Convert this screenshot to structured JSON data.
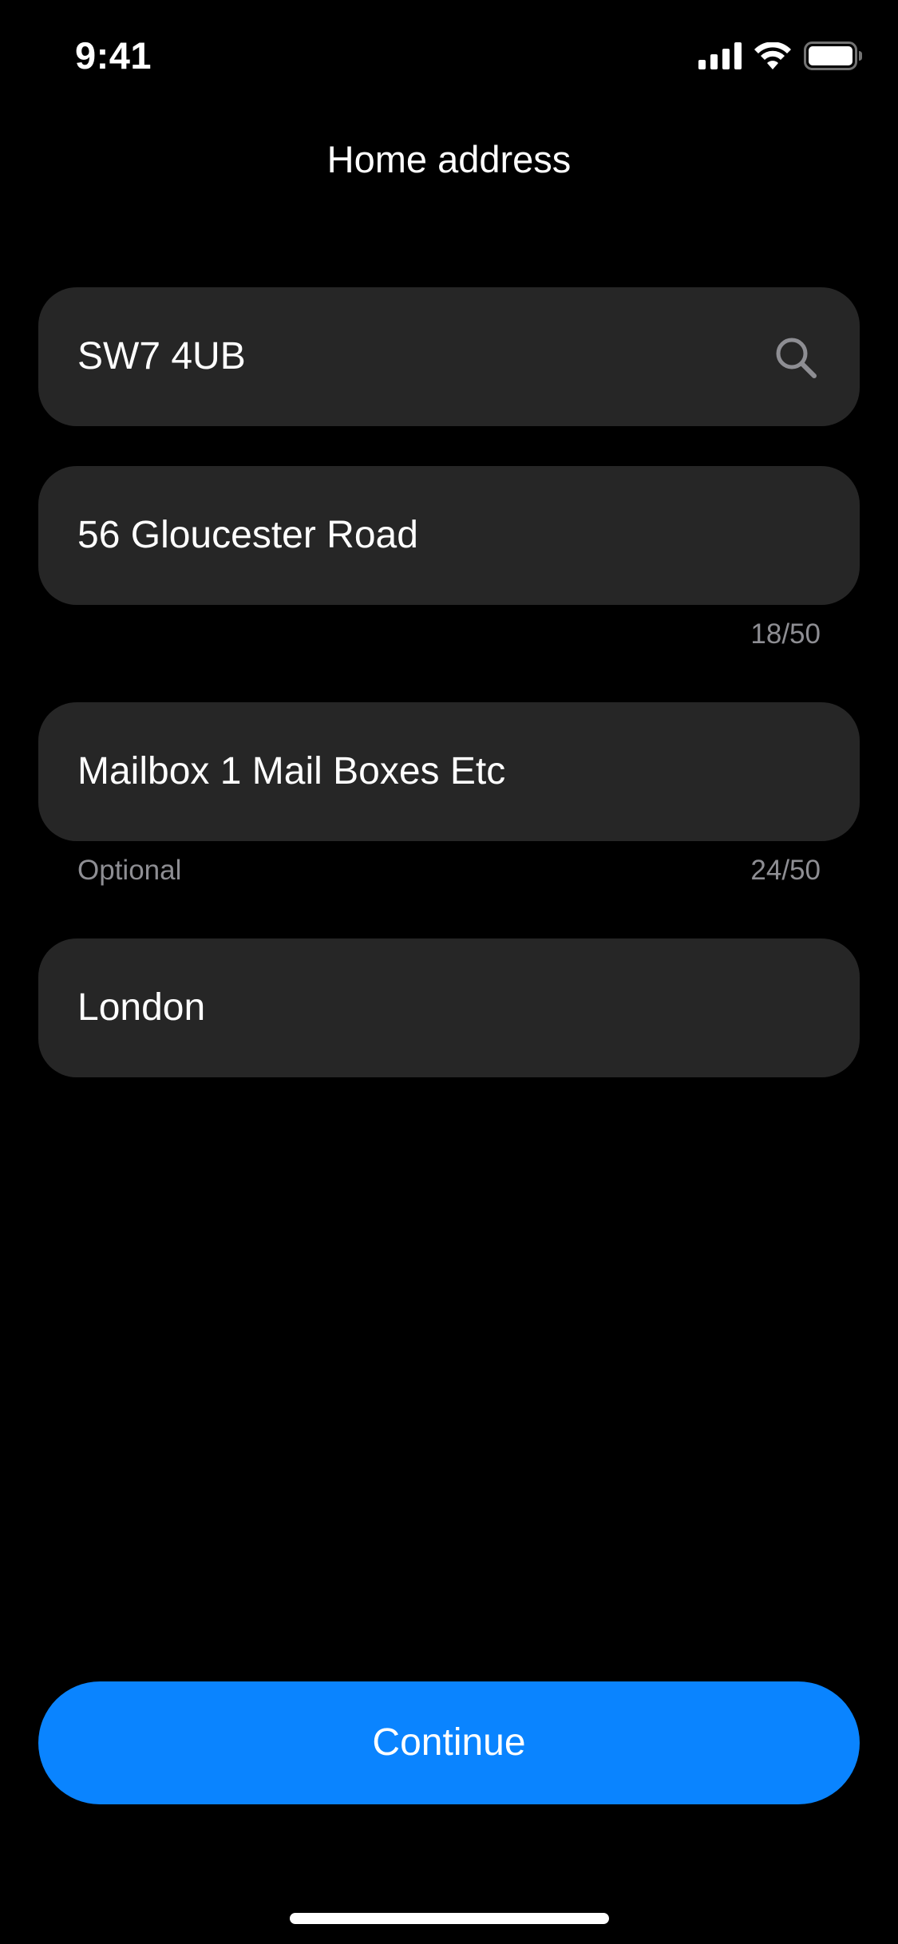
{
  "status_bar": {
    "time": "9:41",
    "icons": [
      "cellular-signal-icon",
      "wifi-icon",
      "battery-icon"
    ]
  },
  "nav": {
    "title": "Home address"
  },
  "form": {
    "postcode": {
      "value": "SW7 4UB",
      "icon": "search-icon"
    },
    "address_line_1": {
      "value": "56 Gloucester Road",
      "counter": "18/50"
    },
    "address_line_2": {
      "value": "Mailbox 1 Mail Boxes Etc",
      "hint": "Optional",
      "counter": "24/50"
    },
    "city": {
      "value": "London"
    }
  },
  "actions": {
    "continue_label": "Continue"
  },
  "colors": {
    "background": "#000000",
    "field_background": "#262626",
    "accent": "#0a84ff",
    "secondary_text": "#8e8e93"
  }
}
